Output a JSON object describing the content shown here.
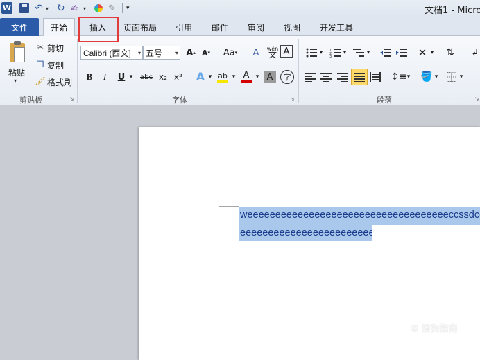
{
  "titlebar": {
    "word_logo": "W",
    "doc_title": "文档1 - Micro"
  },
  "tabs": [
    {
      "label": "文件"
    },
    {
      "label": "开始"
    },
    {
      "label": "插入"
    },
    {
      "label": "页面布局"
    },
    {
      "label": "引用"
    },
    {
      "label": "邮件"
    },
    {
      "label": "审阅"
    },
    {
      "label": "视图"
    },
    {
      "label": "开发工具"
    }
  ],
  "clipboard": {
    "paste": "粘贴",
    "cut": "剪切",
    "copy": "复制",
    "format_painter": "格式刷",
    "group_label": "剪贴板"
  },
  "font": {
    "font_name": "Calibri (西文]",
    "font_size": "五号",
    "group_label": "字体",
    "grow": "A",
    "shrink": "A",
    "change_case": "Aa",
    "clear_format": "A",
    "phonetic": "wén",
    "phonetic_char": "文",
    "char_border": "A",
    "bold": "B",
    "italic": "I",
    "underline": "U",
    "strike": "abc",
    "subscript": "x₂",
    "superscript": "x²",
    "text_effect": "A",
    "highlight": "ab",
    "font_color": "A",
    "char_shading": "A",
    "enclose": "字"
  },
  "paragraph": {
    "group_label": "段落"
  },
  "colors": {
    "accent": "#2a5aa8",
    "highlight_box": "#e23b3b",
    "selection": "#a9c8eb",
    "font_color_red": "#d40000",
    "highlight_yellow": "#f7e600"
  },
  "document": {
    "line1": "weeeeeeeeeeeeeeeeeeeeeeeeeeeeeeeeeeeeccssdcccccc",
    "line2": "eeeeeeeeeeeeeeeeeeeeeeee",
    "para_mark": "↵"
  },
  "watermark": "⑤ 搜狗指南"
}
